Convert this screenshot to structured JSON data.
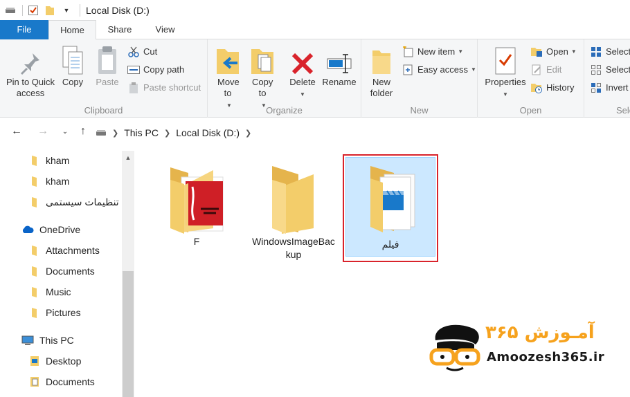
{
  "window": {
    "title": "Local Disk (D:)"
  },
  "tabs": {
    "file": "File",
    "home": "Home",
    "share": "Share",
    "view": "View"
  },
  "ribbon": {
    "clipboard": {
      "label": "Clipboard",
      "pin": "Pin to Quick access",
      "copy": "Copy",
      "paste": "Paste",
      "cut": "Cut",
      "copy_path": "Copy path",
      "paste_shortcut": "Paste shortcut"
    },
    "organize": {
      "label": "Organize",
      "move_to": "Move to",
      "copy_to": "Copy to",
      "delete": "Delete",
      "rename": "Rename"
    },
    "new": {
      "label": "New",
      "new_folder": "New folder",
      "new_item": "New item",
      "easy_access": "Easy access"
    },
    "open": {
      "label": "Open",
      "properties": "Properties",
      "open": "Open",
      "edit": "Edit",
      "history": "History"
    },
    "select": {
      "label": "Sele",
      "select_all": "Select",
      "select_none": "Select",
      "invert": "Invert"
    }
  },
  "address": {
    "crumbs": [
      "This PC",
      "Local Disk (D:)"
    ]
  },
  "nav": {
    "items": [
      "kham",
      "kham",
      "تنظیمات سیستمی",
      "OneDrive",
      "Attachments",
      "Documents",
      "Music",
      "Pictures",
      "This PC",
      "Desktop",
      "Documents"
    ]
  },
  "content": {
    "items": [
      "F",
      "WindowsImageBackup",
      "فیلم"
    ]
  },
  "watermark": {
    "url": "Amoozesh365.ir",
    "brand_fa": "آمـوزش ۳۶۵"
  },
  "colors": {
    "accent": "#1979ca",
    "selection": "#cce8ff",
    "highlight": "#d9232b",
    "folder": "#f3cd6a",
    "brand": "#f6a21d"
  }
}
